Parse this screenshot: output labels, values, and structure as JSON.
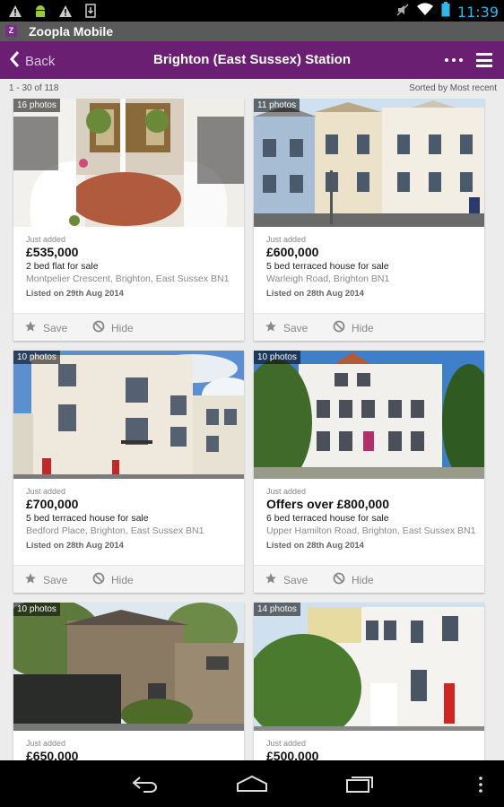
{
  "status_bar": {
    "time": "11:39"
  },
  "app_bar": {
    "logo_letter": "Z",
    "title": "Zoopla Mobile"
  },
  "nav": {
    "back_label": "Back",
    "title": "Brighton (East Sussex) Station"
  },
  "results": {
    "count_text": "1 - 30 of 118",
    "sort_text": "Sorted by Most recent"
  },
  "actions": {
    "save_label": "Save",
    "hide_label": "Hide"
  },
  "listings": [
    {
      "photos": "16 photos",
      "tag": "Just added",
      "price": "£535,000",
      "type": "2 bed flat for sale",
      "address": "Montpelier Crescent, Brighton, East Sussex BN1",
      "listed": "Listed on 29th Aug 2014"
    },
    {
      "photos": "11 photos",
      "tag": "Just added",
      "price": "£600,000",
      "type": "5 bed terraced house for sale",
      "address": "Warleigh Road, Brighton BN1",
      "listed": "Listed on 28th Aug 2014"
    },
    {
      "photos": "10 photos",
      "tag": "Just added",
      "price": "£700,000",
      "type": "5 bed terraced house for sale",
      "address": "Bedford Place, Brighton, East Sussex BN1",
      "listed": "Listed on 28th Aug 2014"
    },
    {
      "photos": "10 photos",
      "tag": "Just added",
      "price": "Offers over £800,000",
      "type": "6 bed terraced house for sale",
      "address": "Upper Hamilton Road, Brighton, East Sussex BN1",
      "listed": "Listed on 28th Aug 2014"
    },
    {
      "photos": "10 photos",
      "tag": "Just added",
      "price": "£650,000"
    },
    {
      "photos": "14 photos",
      "tag": "Just added",
      "price": "£500,000"
    }
  ]
}
